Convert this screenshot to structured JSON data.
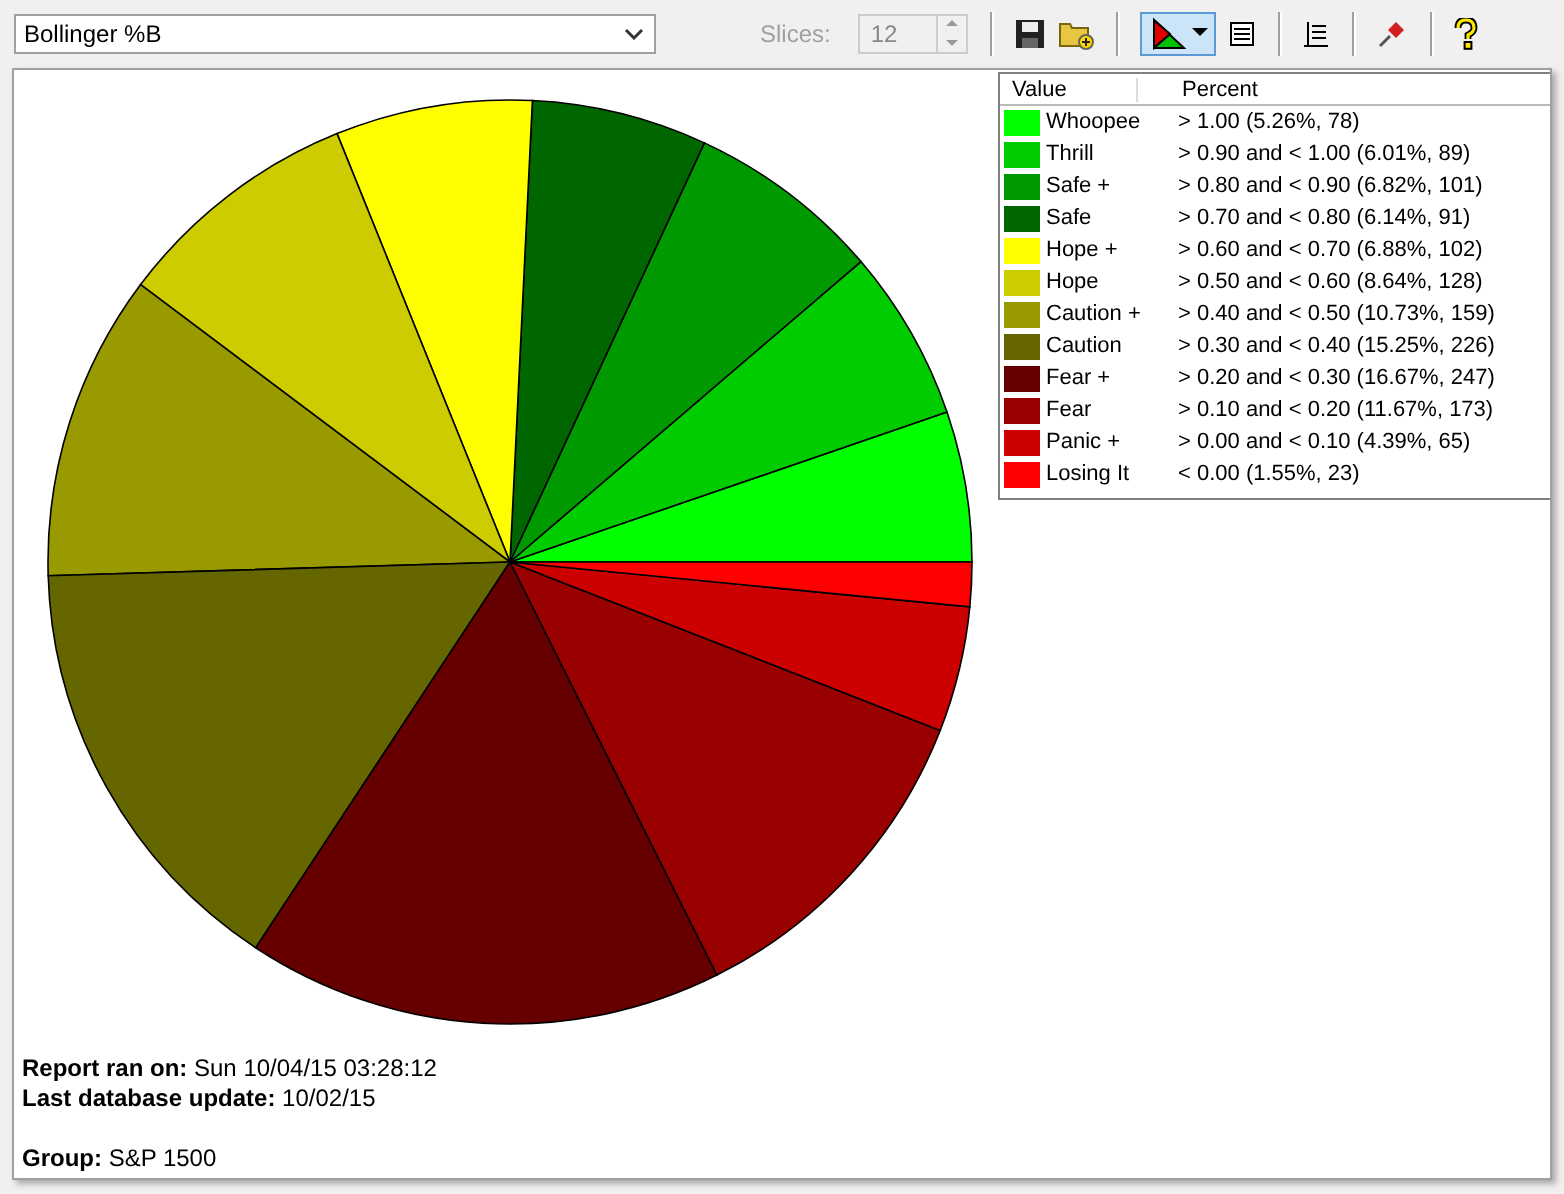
{
  "toolbar": {
    "indicator": "Bollinger %B",
    "slices_label": "Slices:",
    "slices_value": "12",
    "slices_disabled": true,
    "chart_button_pressed": true
  },
  "legend": {
    "columns": [
      "Value",
      "Percent"
    ],
    "items": [
      {
        "range": "> 1.00 (5.26%, 78)",
        "color": "#00ff00"
      },
      {
        "range": "> 0.90 and < 1.00 (6.01%, 89)",
        "color": "#00cc00"
      },
      {
        "range": "> 0.80 and < 0.90 (6.82%, 101)",
        "color": "#009900"
      },
      {
        "range": "> 0.70 and < 0.80 (6.14%, 91)",
        "color": "#006600"
      },
      {
        "range": "> 0.60 and < 0.70 (6.88%, 102)",
        "color": "#ffff00"
      },
      {
        "range": "> 0.50 and < 0.60 (8.64%, 128)",
        "color": "#cccc00"
      },
      {
        "range": "> 0.40 and < 0.50 (10.73%, 159)",
        "color": "#999900"
      },
      {
        "range": "> 0.30 and < 0.40 (15.25%, 226)",
        "color": "#666600"
      },
      {
        "range": "> 0.20 and < 0.30 (16.67%, 247)",
        "color": "#660000"
      },
      {
        "range": "> 0.10 and < 0.20 (11.67%, 173)",
        "color": "#990000"
      },
      {
        "range": "> 0.00 and < 0.10 (4.39%, 65)",
        "color": "#cc0000"
      },
      {
        "range": "< 0.00 (1.55%, 23)",
        "color": "#ff0000"
      }
    ]
  },
  "chart_data": {
    "type": "pie",
    "categories": [
      "Whoopee",
      "Thrill",
      "Safe +",
      "Safe",
      "Hope +",
      "Hope",
      "Caution +",
      "Caution",
      "Fear +",
      "Fear",
      "Panic +",
      "Losing It"
    ],
    "values": [
      5.26,
      6.01,
      6.82,
      6.14,
      6.88,
      8.64,
      10.73,
      15.25,
      16.67,
      11.67,
      4.39,
      1.55
    ]
  },
  "report": {
    "lines": [
      "**Report ran on:** Sun 10/04/15 03:28:12",
      "**Last database update:** 10/02/15"
    ],
    "group": "**Group:** S&P 1500"
  }
}
